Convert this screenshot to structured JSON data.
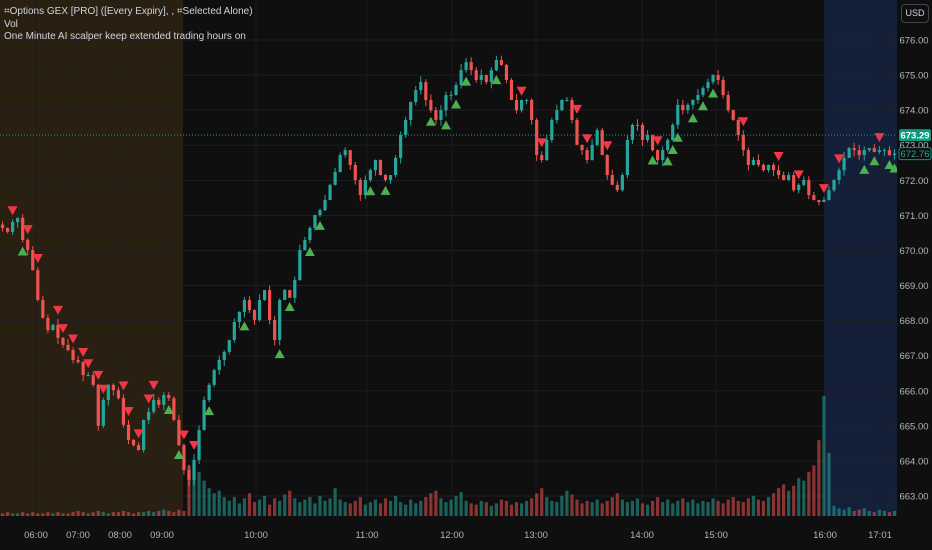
{
  "legend": {
    "line1": "⌗Options GEX [PRO] ([Every Expiry], , ⌗Selected Alone)",
    "line2": "Vol",
    "line3": "One Minute AI scalper keep extended trading hours on"
  },
  "currency_button": "USD",
  "colors": {
    "up": "#26a69a",
    "down": "#ef5350",
    "buy_marker": "#4caf50",
    "sell_marker": "#f23645",
    "premarket_bg": "#2a2012",
    "postmarket_bg": "#14203a",
    "background": "#0f0f0f"
  },
  "chart_data": {
    "type": "candlestick",
    "ylim": [
      662.2,
      676.6
    ],
    "y_ticks": [
      "676.00",
      "675.00",
      "674.00",
      "673.00",
      "672.00",
      "671.00",
      "670.00",
      "669.00",
      "668.00",
      "667.00",
      "666.00",
      "665.00",
      "664.00",
      "663.00"
    ],
    "x_ticks": [
      "06:00",
      "07:00",
      "08:00",
      "09:00",
      "10:00",
      "11:00",
      "12:00",
      "13:00",
      "14:00",
      "15:00",
      "16:00",
      "17:01"
    ],
    "sessions": {
      "premarket_end": "09:30",
      "postmarket_start": "16:00"
    },
    "last_price": "672.76",
    "marked_price": "673.29",
    "grid": true,
    "close": [
      670.64,
      670.53,
      670.81,
      670.93,
      670.3,
      670.01,
      669.44,
      668.59,
      668.08,
      667.73,
      667.88,
      667.51,
      667.31,
      667.16,
      666.88,
      666.82,
      666.45,
      666.45,
      666.17,
      665.0,
      665.74,
      666.17,
      666.02,
      665.79,
      665.03,
      664.6,
      664.45,
      664.31,
      665.17,
      665.4,
      665.74,
      665.6,
      665.88,
      665.79,
      665.17,
      664.45,
      663.74,
      663.46,
      664.03,
      664.88,
      665.74,
      666.17,
      666.59,
      666.88,
      667.11,
      667.45,
      667.96,
      668.25,
      668.59,
      668.3,
      668.02,
      668.59,
      668.87,
      668.02,
      667.45,
      668.59,
      668.87,
      668.65,
      669.16,
      670.01,
      670.3,
      670.64,
      671.01,
      671.15,
      671.44,
      671.87,
      672.24,
      672.72,
      672.86,
      672.44,
      672.01,
      671.58,
      672.01,
      672.29,
      672.58,
      672.15,
      672.01,
      672.15,
      672.64,
      673.29,
      673.72,
      674.23,
      674.57,
      674.8,
      674.29,
      674.0,
      673.72,
      674.0,
      674.43,
      674.43,
      674.72,
      675.14,
      675.37,
      675.14,
      674.86,
      675.0,
      674.8,
      675.14,
      675.43,
      675.29,
      674.86,
      674.29,
      674.0,
      674.29,
      674.29,
      673.72,
      672.72,
      672.58,
      673.15,
      673.72,
      674.0,
      674.29,
      674.29,
      673.72,
      673.01,
      672.86,
      672.58,
      673.01,
      673.43,
      672.72,
      672.15,
      671.87,
      671.72,
      672.15,
      673.15,
      673.58,
      673.58,
      673.15,
      673.29,
      672.86,
      672.58,
      672.86,
      673.15,
      673.58,
      674.15,
      674.0,
      674.15,
      674.29,
      674.43,
      674.63,
      674.8,
      675.0,
      674.86,
      674.43,
      674.0,
      673.72,
      673.29,
      672.86,
      672.44,
      672.58,
      672.44,
      672.29,
      672.44,
      672.29,
      672.15,
      672.01,
      672.15,
      671.72,
      671.87,
      672.01,
      671.58,
      671.44,
      671.38,
      671.44,
      671.72,
      672.01,
      672.29,
      672.64,
      672.92,
      672.86,
      672.72,
      672.86,
      672.92,
      672.81,
      672.86,
      672.86,
      672.72,
      672.76
    ],
    "volume": [
      2,
      3,
      2,
      2,
      3,
      2,
      3,
      2,
      2,
      3,
      2,
      3,
      2,
      2,
      3,
      4,
      3,
      2,
      3,
      4,
      3,
      2,
      3,
      3,
      4,
      3,
      2,
      3,
      3,
      4,
      3,
      4,
      5,
      4,
      3,
      5,
      4,
      40,
      30,
      35,
      28,
      22,
      18,
      20,
      15,
      12,
      15,
      10,
      14,
      18,
      11,
      13,
      16,
      9,
      14,
      12,
      17,
      20,
      14,
      11,
      13,
      15,
      10,
      16,
      12,
      14,
      22,
      13,
      11,
      10,
      12,
      15,
      9,
      11,
      13,
      10,
      14,
      12,
      16,
      11,
      9,
      13,
      10,
      12,
      15,
      18,
      20,
      14,
      11,
      13,
      16,
      19,
      12,
      10,
      9,
      12,
      11,
      8,
      10,
      13,
      12,
      9,
      11,
      10,
      12,
      14,
      18,
      22,
      15,
      12,
      11,
      16,
      20,
      17,
      13,
      10,
      12,
      11,
      13,
      10,
      12,
      15,
      18,
      13,
      11,
      12,
      14,
      10,
      9,
      12,
      15,
      11,
      13,
      10,
      12,
      14,
      11,
      13,
      10,
      12,
      11,
      14,
      12,
      10,
      13,
      15,
      12,
      11,
      14,
      16,
      13,
      12,
      15,
      18,
      22,
      25,
      20,
      24,
      30,
      28,
      35,
      40,
      60,
      95,
      50,
      8,
      6,
      5,
      7,
      4,
      5,
      6,
      4,
      3,
      5,
      4,
      3,
      4,
      3,
      3
    ],
    "sell_signals": [
      2,
      5,
      7,
      11,
      12,
      14,
      16,
      17,
      19,
      20,
      24,
      25,
      27,
      29,
      30,
      36,
      38,
      103,
      107,
      114,
      116,
      120,
      130,
      147,
      154,
      158,
      163,
      166,
      174,
      179
    ],
    "buy_signals": [
      4,
      33,
      35,
      41,
      48,
      55,
      57,
      61,
      63,
      73,
      76,
      85,
      88,
      90,
      92,
      98,
      129,
      132,
      133,
      134,
      137,
      139,
      141,
      171,
      173,
      176,
      177,
      178
    ]
  }
}
